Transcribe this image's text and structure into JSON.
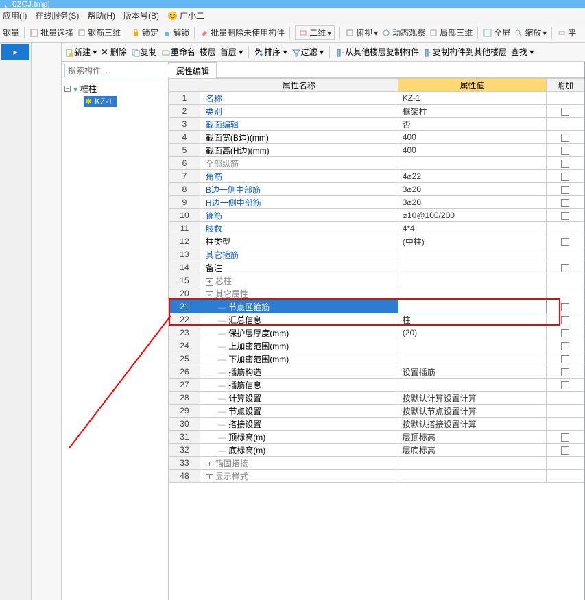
{
  "title_suffix": "、02CJ.tmp]",
  "menus": [
    "应用(I)",
    "在线服务(S)",
    "帮助(H)",
    "版本号(B)"
  ],
  "menu_user_icon": "😊",
  "menu_user": "广小二",
  "toolbar1": [
    "钢量",
    "批量选择",
    "钢筋三维",
    "锁定",
    "解锁",
    "批量删除未使用构件"
  ],
  "toolbar1_dd": "二维",
  "toolbar1_right": [
    "俯视",
    "动态观察",
    "局部三维",
    "全屏",
    "缩放",
    "平"
  ],
  "toolbar2": [
    "新建",
    "删除",
    "复制",
    "重命名"
  ],
  "toolbar2_floor": "楼层",
  "toolbar2_first": "首层",
  "toolbar2_sort": "排序",
  "toolbar2_filter": "过滤",
  "toolbar2_actions": [
    "从其他楼层复制构件",
    "复制构件到其他楼层",
    "查找"
  ],
  "search_placeholder": "搜索构件...",
  "tree_root": "框柱",
  "tree_child": "KZ-1",
  "tab": "属性编辑",
  "headers": {
    "name": "属性名称",
    "value": "属性值",
    "extra": "附加"
  },
  "rows": [
    {
      "n": "1",
      "name": "名称",
      "val": "KZ-1",
      "cls": "link",
      "chk": false
    },
    {
      "n": "2",
      "name": "类别",
      "val": "框架柱",
      "cls": "link",
      "chk": true
    },
    {
      "n": "3",
      "name": "截面编辑",
      "val": "否",
      "cls": "link",
      "chk": false
    },
    {
      "n": "4",
      "name": "截面宽(B边)(mm)",
      "val": "400",
      "cls": "",
      "chk": true
    },
    {
      "n": "5",
      "name": "截面高(H边)(mm)",
      "val": "400",
      "cls": "",
      "chk": true
    },
    {
      "n": "6",
      "name": "全部纵筋",
      "val": "",
      "cls": "gray",
      "chk": true
    },
    {
      "n": "7",
      "name": "角筋",
      "val": "4⌀22",
      "cls": "link",
      "chk": true
    },
    {
      "n": "8",
      "name": "B边一侧中部筋",
      "val": "3⌀20",
      "cls": "link",
      "chk": true
    },
    {
      "n": "9",
      "name": "H边一侧中部筋",
      "val": "3⌀20",
      "cls": "link",
      "chk": true
    },
    {
      "n": "10",
      "name": "箍筋",
      "val": "⌀10@100/200",
      "cls": "link",
      "chk": true
    },
    {
      "n": "11",
      "name": "肢数",
      "val": "4*4",
      "cls": "link",
      "chk": false
    },
    {
      "n": "12",
      "name": "柱类型",
      "val": "(中柱)",
      "cls": "",
      "chk": true
    },
    {
      "n": "13",
      "name": "其它箍筋",
      "val": "",
      "cls": "link",
      "chk": false
    },
    {
      "n": "14",
      "name": "备注",
      "val": "",
      "cls": "",
      "chk": true
    },
    {
      "n": "15",
      "name": "芯柱",
      "exp": "+",
      "cls": "gray",
      "chk": false
    },
    {
      "n": "20",
      "name": "其它属性",
      "exp": "-",
      "cls": "gray",
      "chk": false
    },
    {
      "n": "21",
      "name": "节点区箍筋",
      "val": "",
      "cls": "",
      "indent": true,
      "chk": true,
      "sel": true
    },
    {
      "n": "22",
      "name": "汇总信息",
      "val": "柱",
      "cls": "",
      "indent": true,
      "chk": true
    },
    {
      "n": "23",
      "name": "保护层厚度(mm)",
      "val": "(20)",
      "cls": "",
      "indent": true,
      "chk": true
    },
    {
      "n": "24",
      "name": "上加密范围(mm)",
      "val": "",
      "cls": "",
      "indent": true,
      "chk": true
    },
    {
      "n": "25",
      "name": "下加密范围(mm)",
      "val": "",
      "cls": "",
      "indent": true,
      "chk": true
    },
    {
      "n": "26",
      "name": "插筋构造",
      "val": "设置插筋",
      "cls": "",
      "indent": true,
      "chk": true
    },
    {
      "n": "27",
      "name": "插筋信息",
      "val": "",
      "cls": "",
      "indent": true,
      "chk": true
    },
    {
      "n": "28",
      "name": "计算设置",
      "val": "按默认计算设置计算",
      "cls": "",
      "indent": true,
      "chk": false
    },
    {
      "n": "29",
      "name": "节点设置",
      "val": "按默认节点设置计算",
      "cls": "",
      "indent": true,
      "chk": false
    },
    {
      "n": "30",
      "name": "搭接设置",
      "val": "按默认搭接设置计算",
      "cls": "",
      "indent": true,
      "chk": false
    },
    {
      "n": "31",
      "name": "顶标高(m)",
      "val": "层顶标高",
      "cls": "",
      "indent": true,
      "chk": true
    },
    {
      "n": "32",
      "name": "底标高(m)",
      "val": "层底标高",
      "cls": "",
      "indent": true,
      "chk": true
    },
    {
      "n": "33",
      "name": "锚固搭接",
      "exp": "+",
      "cls": "gray",
      "chk": false
    },
    {
      "n": "48",
      "name": "显示样式",
      "exp": "+",
      "cls": "gray",
      "chk": false
    }
  ]
}
